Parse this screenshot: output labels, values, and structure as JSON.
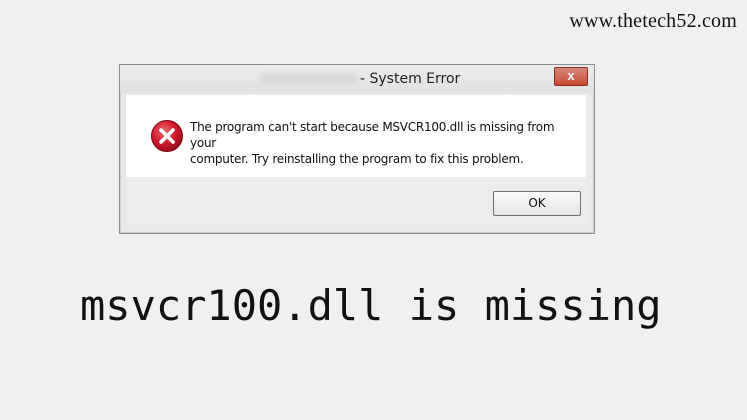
{
  "watermark": "www.thetech52.com",
  "dialog": {
    "title": "- System Error",
    "close_label": "x",
    "icon": "error-icon",
    "message_line1": "The program can't start because MSVCR100.dll is missing from your",
    "message_line2": "computer. Try reinstalling the program to fix this problem.",
    "ok_label": "OK"
  },
  "caption": "msvcr100.dll is missing",
  "colors": {
    "background": "#f0f0f0",
    "dialog_white": "#ffffff",
    "close_button": "#c84934",
    "error_red": "#d0192b"
  }
}
